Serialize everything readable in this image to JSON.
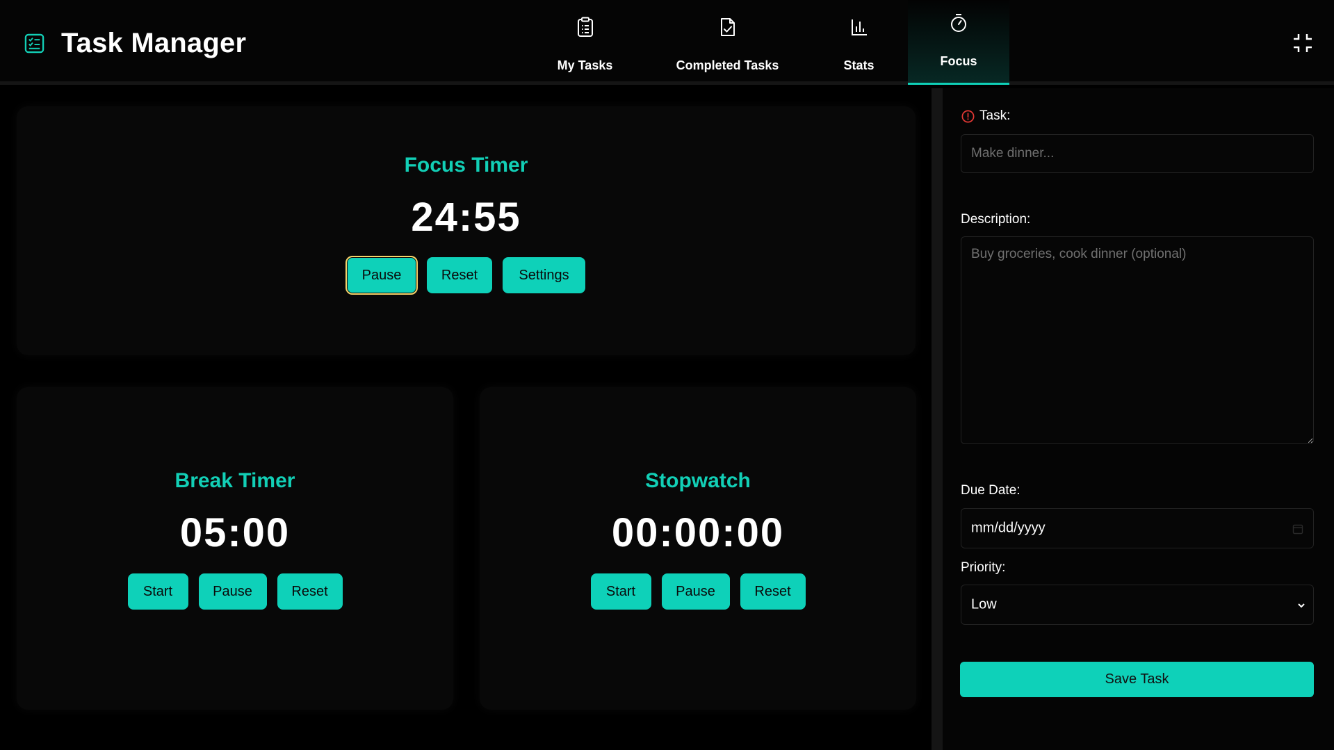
{
  "app": {
    "title": "Task Manager",
    "logo_icon": "checklist-icon"
  },
  "nav": {
    "items": [
      {
        "label": "My Tasks",
        "icon": "clipboard-list-icon",
        "active": false
      },
      {
        "label": "Completed Tasks",
        "icon": "file-check-icon",
        "active": false
      },
      {
        "label": "Stats",
        "icon": "bar-chart-icon",
        "active": false
      },
      {
        "label": "Focus",
        "icon": "stopwatch-icon",
        "active": true
      }
    ],
    "exit_fullscreen_icon": "minimize-icon"
  },
  "focus_timer": {
    "title": "Focus Timer",
    "time": "24:55",
    "buttons": {
      "pause": "Pause",
      "reset": "Reset",
      "settings": "Settings"
    }
  },
  "break_timer": {
    "title": "Break Timer",
    "time": "05:00",
    "buttons": {
      "start": "Start",
      "pause": "Pause",
      "reset": "Reset"
    }
  },
  "stopwatch": {
    "title": "Stopwatch",
    "time": "00:00:00",
    "buttons": {
      "start": "Start",
      "pause": "Pause",
      "reset": "Reset"
    }
  },
  "task_form": {
    "task_label": "Task:",
    "task_placeholder": "Make dinner...",
    "task_value": "",
    "description_label": "Description:",
    "description_placeholder": "Buy groceries, cook dinner (optional)",
    "description_value": "",
    "due_date_label": "Due Date:",
    "due_date_value": "mm/dd/yyyy",
    "priority_label": "Priority:",
    "priority_value": "Low",
    "save_label": "Save Task"
  },
  "colors": {
    "accent": "#0ed1b9",
    "background": "#000000",
    "card": "#080808",
    "required": "#e53935",
    "focus_ring": "#f5d36a"
  }
}
